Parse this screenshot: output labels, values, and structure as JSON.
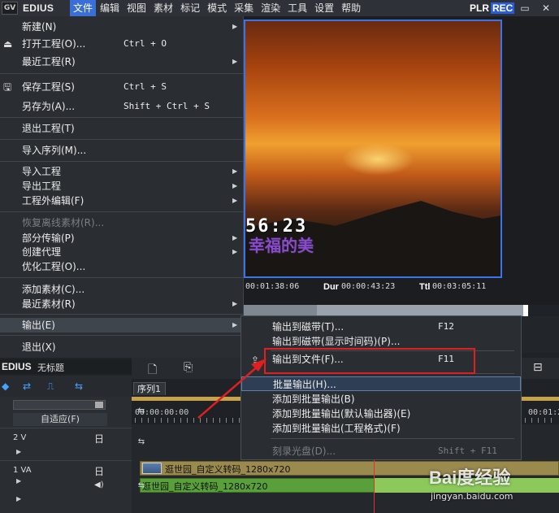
{
  "app": {
    "name": "EDIUS",
    "logo": "GV"
  },
  "menubar": {
    "items": [
      "文件",
      "编辑",
      "视图",
      "素材",
      "标记",
      "模式",
      "采集",
      "渲染",
      "工具",
      "设置",
      "帮助"
    ],
    "active_index": 0,
    "plr": "PLR",
    "rec": "REC",
    "min": "▭",
    "close": "✕"
  },
  "player": {
    "timecode_overlay": "56:23",
    "subtitle_overlay": "幸福的美",
    "tc_in": "00:01:38:06",
    "dur_label": "Dur",
    "dur_value": "00:00:43:23",
    "ttl_label": "Ttl",
    "ttl_value": "00:03:05:11"
  },
  "file_menu": [
    {
      "label": "新建(N)",
      "shortcut": "",
      "submenu": true,
      "disabled": false,
      "icon": ""
    },
    {
      "label": "打开工程(O)...",
      "shortcut": "Ctrl + O",
      "submenu": false,
      "disabled": false,
      "icon": "open-folder-icon"
    },
    {
      "label": "最近工程(R)",
      "shortcut": "",
      "submenu": true,
      "disabled": false,
      "icon": ""
    },
    {
      "label": "保存工程(S)",
      "shortcut": "Ctrl + S",
      "submenu": false,
      "disabled": false,
      "icon": "save-icon"
    },
    {
      "label": "另存为(A)...",
      "shortcut": "Shift + Ctrl + S",
      "submenu": false,
      "disabled": false,
      "icon": ""
    },
    {
      "label": "退出工程(T)",
      "shortcut": "",
      "submenu": false,
      "disabled": false,
      "icon": ""
    },
    {
      "label": "导入序列(M)...",
      "shortcut": "",
      "submenu": false,
      "disabled": false,
      "icon": ""
    },
    {
      "label": "导入工程",
      "shortcut": "",
      "submenu": true,
      "disabled": false,
      "icon": ""
    },
    {
      "label": "导出工程",
      "shortcut": "",
      "submenu": true,
      "disabled": false,
      "icon": ""
    },
    {
      "label": "工程外编辑(F)",
      "shortcut": "",
      "submenu": true,
      "disabled": false,
      "icon": ""
    },
    {
      "label": "恢复离线素材(R)...",
      "shortcut": "",
      "submenu": false,
      "disabled": true,
      "icon": ""
    },
    {
      "label": "部分传输(P)",
      "shortcut": "",
      "submenu": true,
      "disabled": false,
      "icon": ""
    },
    {
      "label": "创建代理",
      "shortcut": "",
      "submenu": true,
      "disabled": false,
      "icon": ""
    },
    {
      "label": "优化工程(O)...",
      "shortcut": "",
      "submenu": false,
      "disabled": false,
      "icon": ""
    },
    {
      "label": "添加素材(C)...",
      "shortcut": "",
      "submenu": false,
      "disabled": false,
      "icon": ""
    },
    {
      "label": "最近素材(R)",
      "shortcut": "",
      "submenu": true,
      "disabled": false,
      "icon": ""
    },
    {
      "label": "输出(E)",
      "shortcut": "",
      "submenu": true,
      "disabled": false,
      "icon": ""
    },
    {
      "label": "退出(X)",
      "shortcut": "",
      "submenu": false,
      "disabled": false,
      "icon": ""
    }
  ],
  "output_submenu": [
    {
      "label": "输出到磁带(T)...",
      "shortcut": "F12",
      "disabled": false
    },
    {
      "label": "输出到磁带(显示时间码)(P)...",
      "shortcut": "",
      "disabled": false
    },
    {
      "label": "输出到文件(F)...",
      "shortcut": "F11",
      "disabled": false
    },
    {
      "label": "批量输出(H)...",
      "shortcut": "",
      "disabled": false
    },
    {
      "label": "添加到批量输出(B)",
      "shortcut": "",
      "disabled": false
    },
    {
      "label": "添加到批量输出(默认输出器)(E)",
      "shortcut": "",
      "disabled": false
    },
    {
      "label": "添加到批量输出(工程格式)(F)",
      "shortcut": "",
      "disabled": false
    },
    {
      "label": "刻录光盘(D)...",
      "shortcut": "Shift + F11",
      "disabled": true
    }
  ],
  "project": {
    "brand": "EDIUS",
    "title": "无标题"
  },
  "timeline": {
    "sequence_tab": "序列1",
    "fit_label": "自适应(F)",
    "ruler_start": "00:00:00:00",
    "ruler_end": "00:01:2",
    "tracks": [
      {
        "name": "2 V"
      },
      {
        "name": "1 VA"
      }
    ],
    "clip_video": "逛世园_自定义转码_1280x720",
    "clip_audio": "逛世园_自定义转码_1280x720"
  },
  "watermark": {
    "brand": "Bai度经验",
    "url": "jingyan.baidu.com"
  },
  "colors": {
    "accent": "#3a6fd8",
    "highlight_box": "#e02020",
    "rec": "#2b5cd6"
  }
}
